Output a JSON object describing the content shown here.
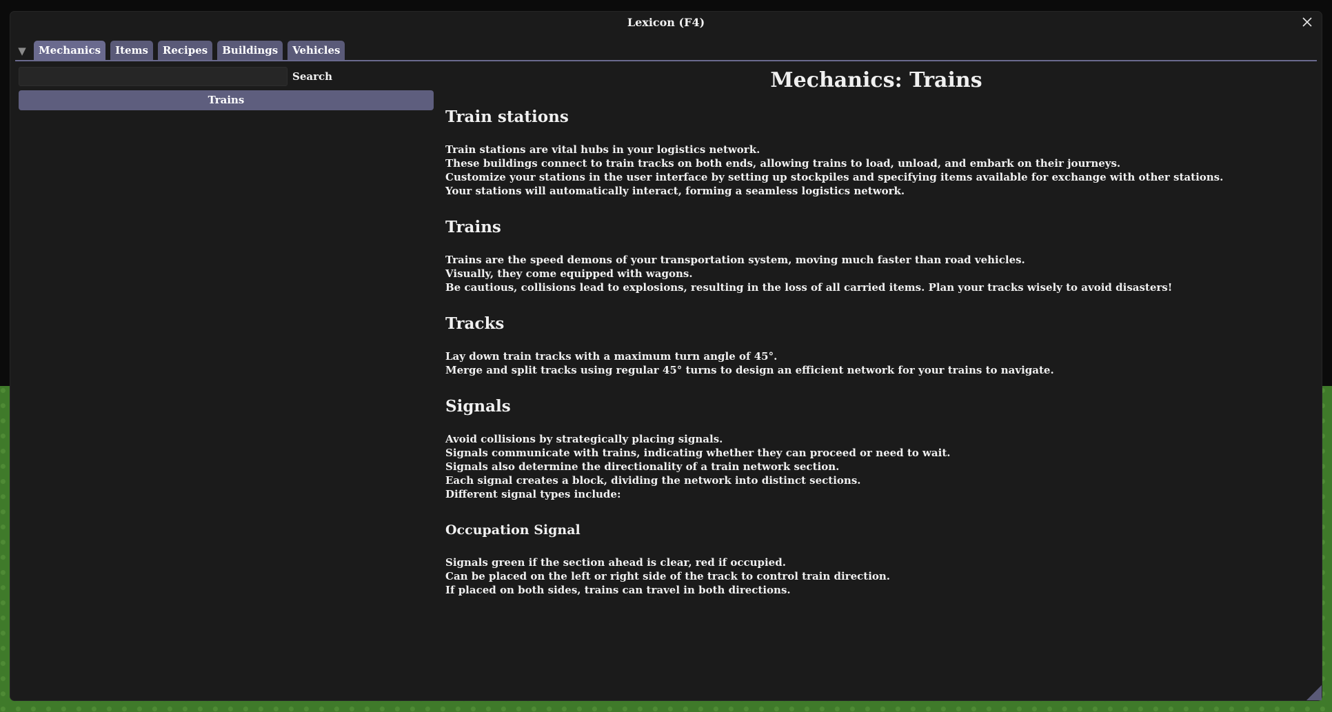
{
  "window": {
    "title": "Lexicon (F4)"
  },
  "tabs": [
    {
      "label": "Mechanics",
      "active": true
    },
    {
      "label": "Items",
      "active": false
    },
    {
      "label": "Recipes",
      "active": false
    },
    {
      "label": "Buildings",
      "active": false
    },
    {
      "label": "Vehicles",
      "active": false
    }
  ],
  "sidebar": {
    "search": {
      "value": "",
      "placeholder": "",
      "button_label": "Search"
    },
    "items": [
      {
        "label": "Trains",
        "selected": true
      }
    ]
  },
  "content": {
    "title": "Mechanics: Trains",
    "sections": [
      {
        "heading": "Train stations",
        "lines": [
          "Train stations are vital hubs in your logistics network.",
          "These buildings connect to train tracks on both ends, allowing trains to load, unload, and embark on their journeys.",
          "Customize your stations in the user interface by setting up stockpiles and specifying items available for exchange with other stations.",
          "Your stations will automatically interact, forming a seamless logistics network."
        ]
      },
      {
        "heading": "Trains",
        "lines": [
          "Trains are the speed demons of your transportation system, moving much faster than road vehicles.",
          "Visually, they come equipped with wagons.",
          "Be cautious, collisions lead to explosions, resulting in the loss of all carried items. Plan your tracks wisely to avoid disasters!"
        ]
      },
      {
        "heading": "Tracks",
        "lines": [
          "Lay down train tracks with a maximum turn angle of 45°.",
          "Merge and split tracks using regular 45° turns to design an efficient network for your trains to navigate."
        ]
      },
      {
        "heading": "Signals",
        "lines": [
          "Avoid collisions by strategically placing signals.",
          "Signals communicate with trains, indicating whether they can proceed or need to wait.",
          "Signals also determine the directionality of a train network section.",
          "Each signal creates a block, dividing the network into distinct sections.",
          "Different signal types include:"
        ]
      },
      {
        "subheading": "Occupation Signal",
        "lines": [
          "Signals green if the section ahead is clear, red if occupied.",
          "Can be placed on the left or right side of the track to control train direction.",
          "If placed on both sides, trains can travel in both directions."
        ]
      }
    ]
  },
  "colors": {
    "window_bg": "#1b1b1b",
    "tab_bg": "#5a5a78",
    "selected_item_bg": "#5e5e7e",
    "world_grass": "#3f7a2a"
  },
  "icons": {
    "close": "close-icon",
    "collapse": "triangle-down-icon",
    "resize": "resize-grip-icon"
  }
}
